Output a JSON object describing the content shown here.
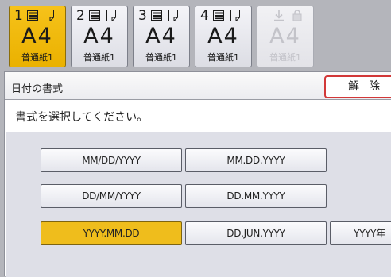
{
  "trays": [
    {
      "number": "1",
      "size": "A4",
      "paper": "普通紙1",
      "state": "selected",
      "icons": [
        "paper-stack-icon",
        "sheet-icon"
      ]
    },
    {
      "number": "2",
      "size": "A4",
      "paper": "普通紙1",
      "state": "normal",
      "icons": [
        "paper-stack-icon",
        "sheet-icon"
      ]
    },
    {
      "number": "3",
      "size": "A4",
      "paper": "普通紙1",
      "state": "normal",
      "icons": [
        "paper-stack-icon",
        "sheet-icon"
      ]
    },
    {
      "number": "4",
      "size": "A4",
      "paper": "普通紙1",
      "state": "normal",
      "icons": [
        "paper-stack-icon",
        "sheet-icon"
      ]
    },
    {
      "number": "",
      "size": "A4",
      "paper": "普通紙1",
      "state": "disabled",
      "icons": [
        "bypass-download-icon",
        "lock-icon"
      ]
    }
  ],
  "dialog": {
    "title": "日付の書式",
    "cancel_label": "解除",
    "instruction": "書式を選択してください。",
    "formats": [
      "MM/DD/YYYY",
      "MM.DD.YYYY",
      "DD/MM/YYYY",
      "DD.MM.YYYY",
      "YYYY.MM.DD",
      "DD.JUN.YYYY",
      "YYYY年"
    ],
    "selected_format": "YYYY.MM.DD"
  },
  "colors": {
    "selected": "#efbd1c",
    "cancel_border": "#d23838",
    "background": "#b4b5bb",
    "grid_background": "#dedfe7"
  }
}
